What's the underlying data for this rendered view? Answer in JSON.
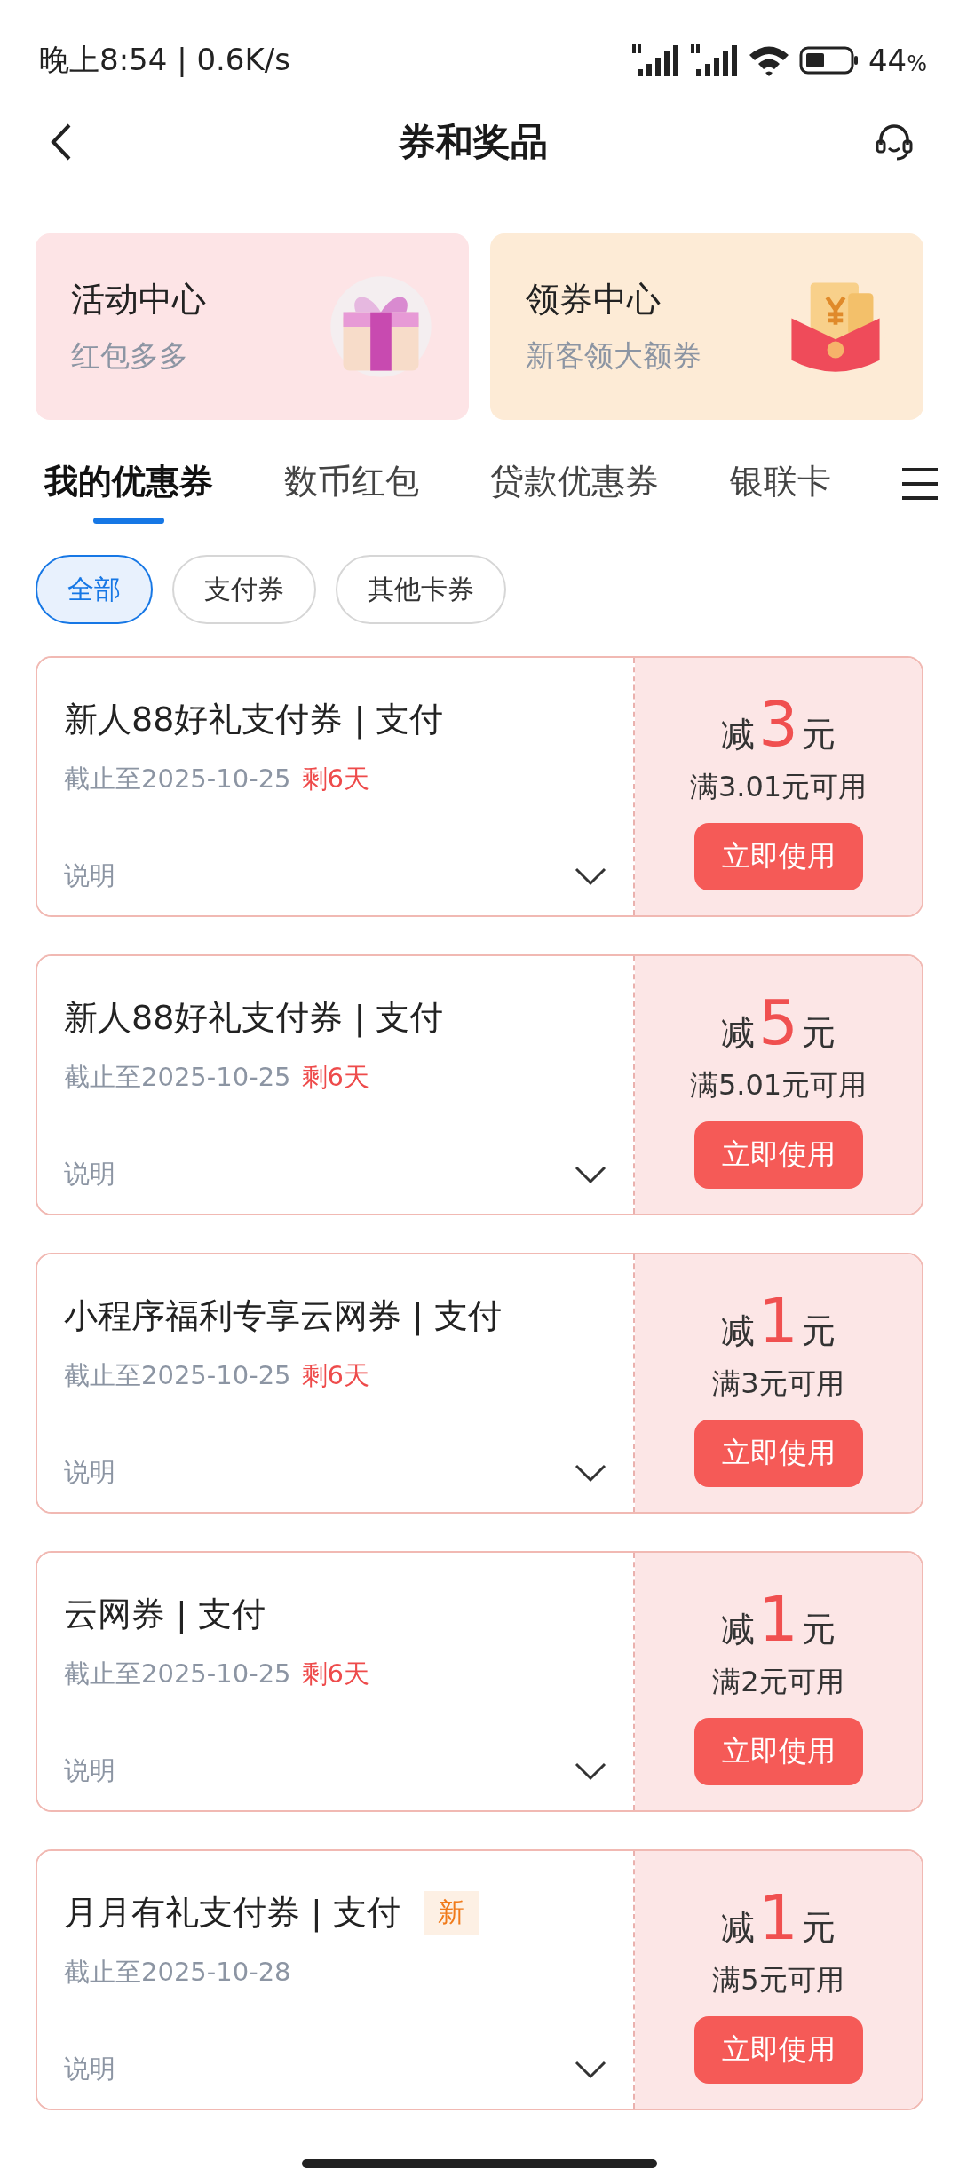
{
  "status_bar": {
    "time": "晚上8:54 | 0.6K/s",
    "battery": "44",
    "battery_unit": "%"
  },
  "header": {
    "title": "券和奖品"
  },
  "promo_cards": [
    {
      "kind": "gift",
      "title": "活动中心",
      "subtitle": "红包多多"
    },
    {
      "kind": "envelope",
      "title": "领券中心",
      "subtitle": "新客领大额券"
    }
  ],
  "tabs": [
    {
      "label": "我的优惠券",
      "selected": true
    },
    {
      "label": "数币红包",
      "selected": false
    },
    {
      "label": "贷款优惠券",
      "selected": false
    },
    {
      "label": "银联卡",
      "selected": false
    }
  ],
  "filters": [
    {
      "label": "全部",
      "selected": true
    },
    {
      "label": "支付券",
      "selected": false
    },
    {
      "label": "其他卡券",
      "selected": false
    }
  ],
  "coupons": [
    {
      "title": "新人88好礼支付券 | 支付",
      "deadline": "截止至2025-10-25",
      "remaining": "剩6天",
      "details": "说明",
      "prefix": "减",
      "amount": "3",
      "unit": "元",
      "condition": "满3.01元可用",
      "button": "立即使用"
    },
    {
      "title": "新人88好礼支付券 | 支付",
      "deadline": "截止至2025-10-25",
      "remaining": "剩6天",
      "details": "说明",
      "prefix": "减",
      "amount": "5",
      "unit": "元",
      "condition": "满5.01元可用",
      "button": "立即使用"
    },
    {
      "title": "小程序福利专享云网券 | 支付",
      "deadline": "截止至2025-10-25",
      "remaining": "剩6天",
      "details": "说明",
      "prefix": "减",
      "amount": "1",
      "unit": "元",
      "condition": "满3元可用",
      "button": "立即使用"
    },
    {
      "title": "云网券 | 支付",
      "deadline": "截止至2025-10-25",
      "remaining": "剩6天",
      "details": "说明",
      "prefix": "减",
      "amount": "1",
      "unit": "元",
      "condition": "满2元可用",
      "button": "立即使用"
    },
    {
      "title": "月月有礼支付券 | 支付",
      "badge": "新",
      "deadline": "截止至2025-10-28",
      "details": "说明",
      "prefix": "减",
      "amount": "1",
      "unit": "元",
      "condition": "满5元可用",
      "button": "立即使用"
    }
  ]
}
